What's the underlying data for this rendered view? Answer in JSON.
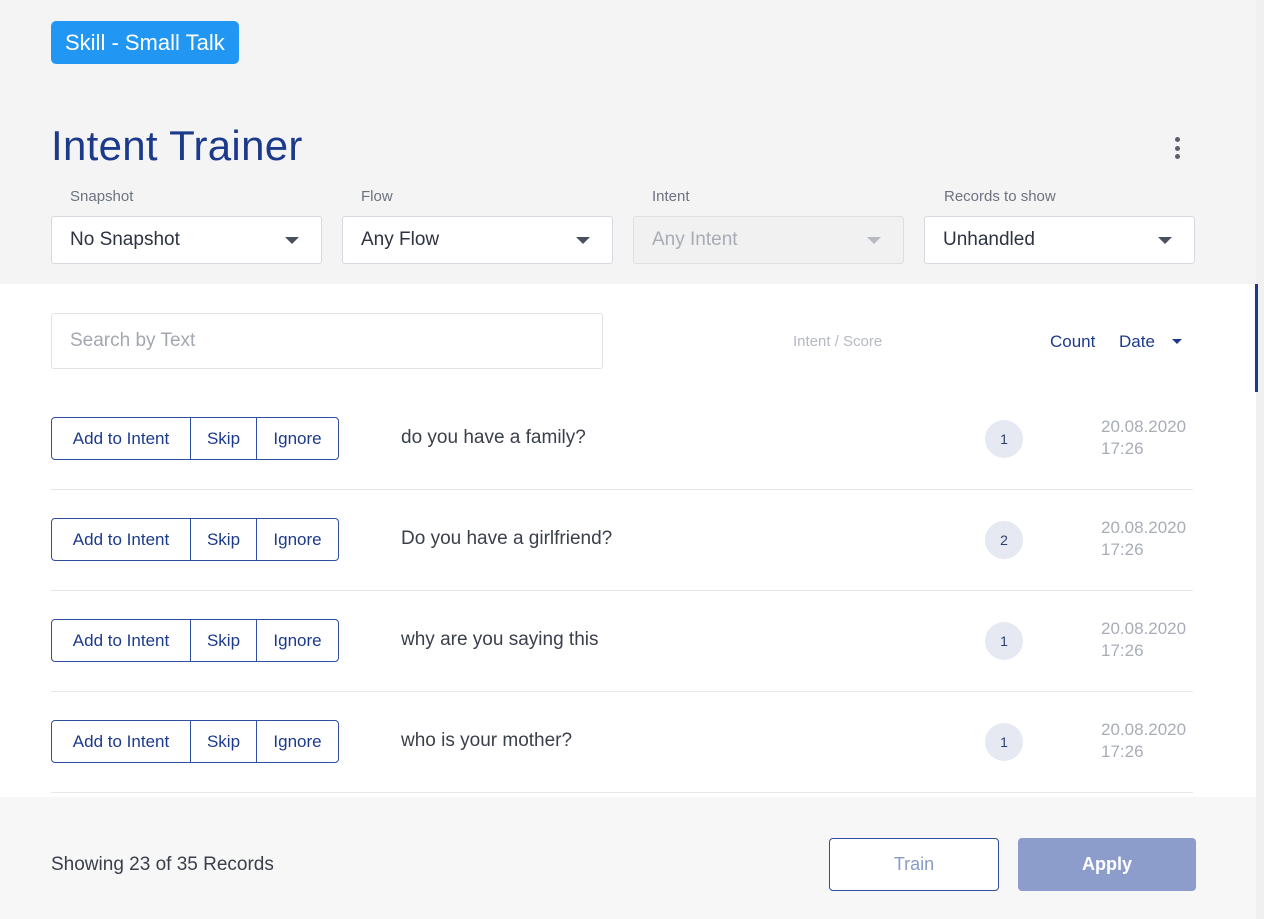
{
  "header": {
    "skill_badge": "Skill - Small Talk",
    "title": "Intent Trainer",
    "menu_icon": "kebab-menu-icon"
  },
  "filters": [
    {
      "label": "Snapshot",
      "value": "No Snapshot",
      "disabled": false
    },
    {
      "label": "Flow",
      "value": "Any Flow",
      "disabled": false
    },
    {
      "label": "Intent",
      "value": "Any Intent",
      "disabled": true
    },
    {
      "label": "Records to show",
      "value": "Unhandled",
      "disabled": false
    }
  ],
  "toolbar": {
    "search_placeholder": "Search by Text",
    "col_intent_score": "Intent / Score",
    "col_count": "Count",
    "col_date": "Date"
  },
  "row_actions": {
    "add": "Add to Intent",
    "skip": "Skip",
    "ignore": "Ignore"
  },
  "rows": [
    {
      "text": "do you have a family?",
      "count": "1",
      "date": "20.08.2020",
      "time": "17:26"
    },
    {
      "text": "Do you have a girlfriend?",
      "count": "2",
      "date": "20.08.2020",
      "time": "17:26"
    },
    {
      "text": "why are you saying this",
      "count": "1",
      "date": "20.08.2020",
      "time": "17:26"
    },
    {
      "text": "who is your mother?",
      "count": "1",
      "date": "20.08.2020",
      "time": "17:26"
    }
  ],
  "footer": {
    "records": "Showing 23 of 35 Records",
    "train": "Train",
    "apply": "Apply"
  },
  "colors": {
    "accent": "#1c3a8c",
    "badge": "#2196f3",
    "apply": "#8c9dcb"
  }
}
